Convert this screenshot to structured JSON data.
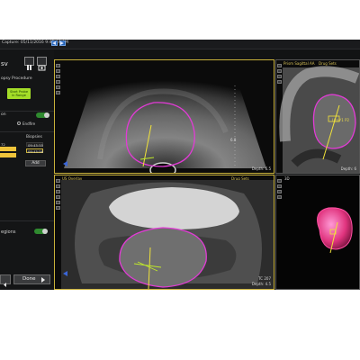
{
  "header": {
    "capture_text": "Capture: 05/11/2016 9:42:46 AM"
  },
  "left_panel": {
    "title": "sv",
    "procedure_label": "opsy Procedure",
    "green_button_lines": [
      "Start Probe",
      "in Range"
    ],
    "section_label": "on",
    "radio_label": "Endfire",
    "biopsies_header": "Biopsies",
    "rows": [
      {
        "left": "72",
        "right": "09:45:55"
      },
      {
        "left": "",
        "right": "09:45:56"
      }
    ],
    "add_label": "Add",
    "regions_label": "egions",
    "done_label": "Done"
  },
  "viewports": {
    "top_left": {
      "depth_text": "Depth: 6.5",
      "side_text": "6.8"
    },
    "top_right": {
      "label": "Prism Sagittal AA",
      "label_right": "Drug Sets",
      "target_label": "Uro#1 P2",
      "depth_text": "Depth: 6"
    },
    "bottom_left": {
      "label": "US Overlay",
      "label_right": "Drug Sets",
      "depth_lines": [
        "TC 207",
        "Depth: 4.5"
      ]
    },
    "bottom_right": {
      "label": "3D"
    }
  },
  "colors": {
    "accent_green": "#a4dd28",
    "viewport_border": "#c9b13a",
    "contour_magenta": "#e23bd6",
    "needle_yellow": "#f0e23a",
    "selected_row": "#f0c43a",
    "toolbar_blue": "#1f5fb6"
  },
  "icons": [
    "pause-icon",
    "camera-icon",
    "play-icon",
    "back-arrow-icon",
    "done-arrow-icon"
  ]
}
